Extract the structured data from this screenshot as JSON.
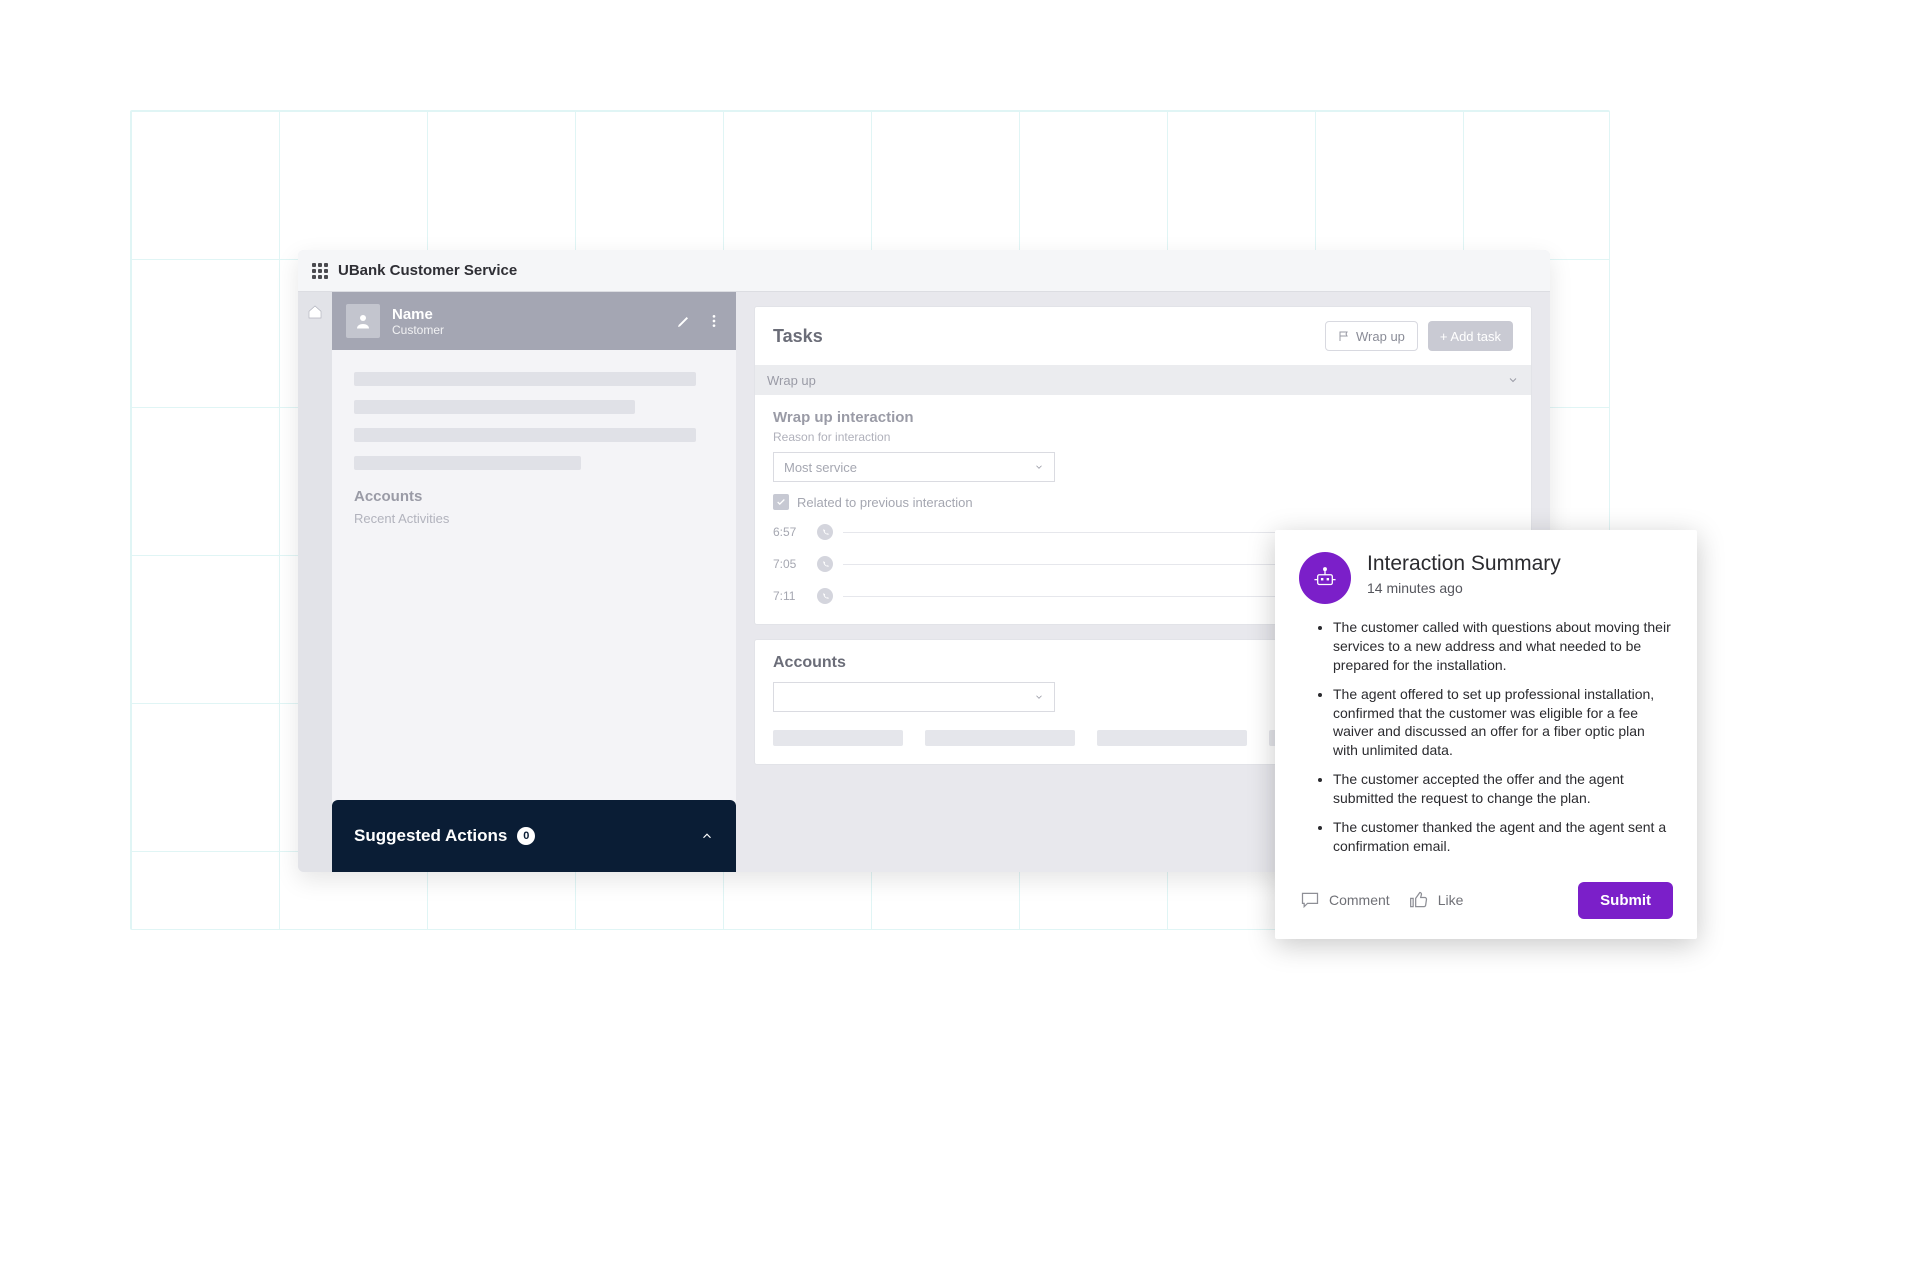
{
  "app": {
    "title": "UBank Customer Service"
  },
  "customer": {
    "name": "Name",
    "role": "Customer"
  },
  "sidebar": {
    "accounts_label": "Accounts",
    "recent_label": "Recent Activities",
    "suggested_label": "Suggested Actions",
    "suggested_count": "0"
  },
  "tasks": {
    "title": "Tasks",
    "wrap_up_btn": "Wrap up",
    "add_task_btn": "+ Add task",
    "tab_label": "Wrap up",
    "wrap_up_heading": "Wrap up interaction",
    "reason_label": "Reason for interaction",
    "reason_value": "Most service",
    "related_label": "Related to previous interaction",
    "timeline": [
      {
        "time": "6:57"
      },
      {
        "time": "7:05"
      },
      {
        "time": "7:11"
      }
    ]
  },
  "accounts_card": {
    "title": "Accounts"
  },
  "popup": {
    "title": "Interaction Summary",
    "time": "14 minutes ago",
    "bullets": [
      "The customer called with questions about moving their services to a new address and what needed to be prepared for the installation.",
      "The agent offered to set up professional installation, confirmed that the customer was eligible for a fee waiver and discussed an offer for a fiber optic plan with unlimited data.",
      "The customer accepted the offer and the agent submitted the request to change the plan.",
      "The customer thanked the agent and the agent sent a confirmation email."
    ],
    "comment_label": "Comment",
    "like_label": "Like",
    "submit_label": "Submit"
  }
}
